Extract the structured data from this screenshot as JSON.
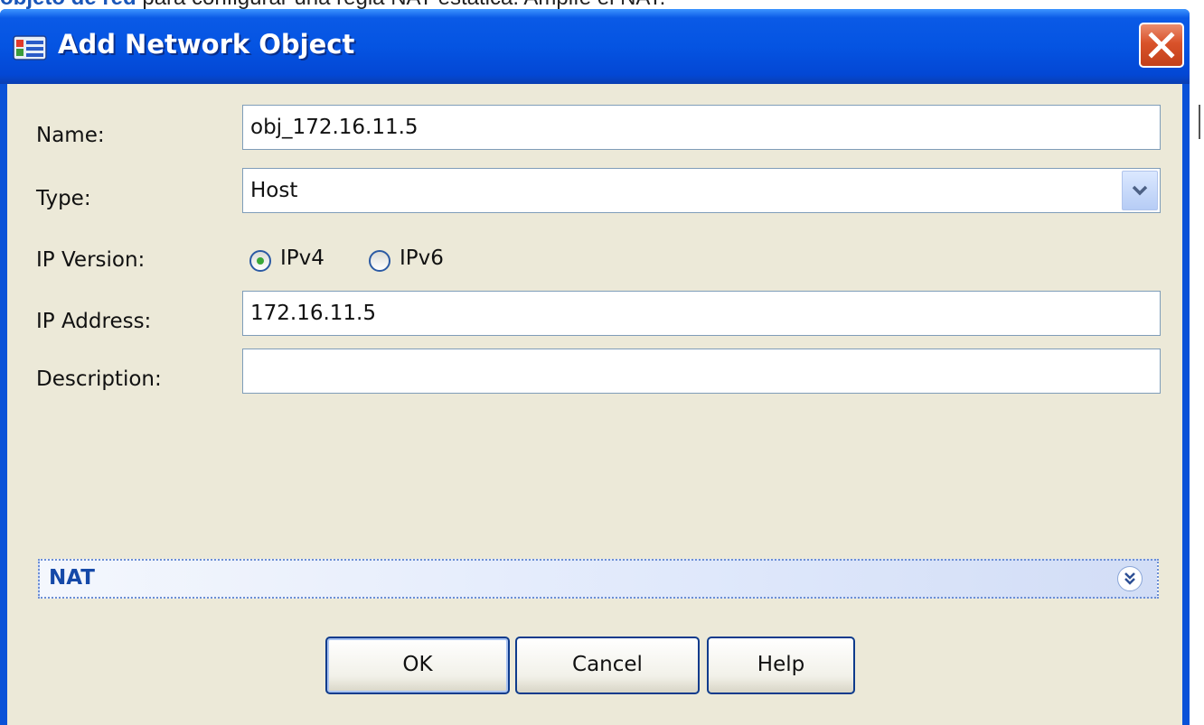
{
  "caption": {
    "bold_text": "objeto de red",
    "text": " para configurar una regla NAT estática. Amplíe el NAT."
  },
  "dialog": {
    "title": "Add Network Object",
    "close_icon": "close-x-icon",
    "app_icon": "network-object-icon"
  },
  "form": {
    "name": {
      "label": "Name:",
      "value": "obj_172.16.11.5"
    },
    "type": {
      "label": "Type:",
      "value": "Host",
      "dropdown_icon": "chevron-down-icon"
    },
    "ip_version": {
      "label": "IP Version:",
      "options": [
        {
          "label": "IPv4",
          "selected": true
        },
        {
          "label": "IPv6",
          "selected": false
        }
      ]
    },
    "ip_address": {
      "label": "IP Address:",
      "value": "172.16.11.5"
    },
    "description": {
      "label": "Description:",
      "value": ""
    }
  },
  "nat": {
    "label": "NAT",
    "expand_icon": "double-chevron-down-icon"
  },
  "buttons": {
    "ok": "OK",
    "cancel": "Cancel",
    "help": "Help"
  },
  "colors": {
    "titlebar": "#0554e2",
    "client_bg": "#ece9d8",
    "close_button": "#d9522a",
    "nat_text": "#1549a8",
    "radio_selected": "#3aa83a"
  }
}
